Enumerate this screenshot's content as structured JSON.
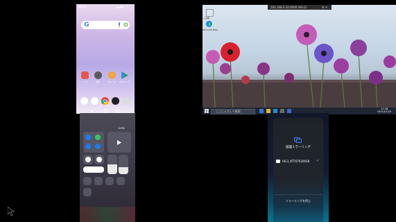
{
  "android": {
    "status_time": "11:48",
    "status_icons": "▲◢ ▮",
    "apps": [
      {
        "label": "ツール",
        "color": "#e6574a"
      },
      {
        "label": "設定",
        "color": "#5a5a5a"
      },
      {
        "label": "アルバム",
        "color": "#f2a63c"
      },
      {
        "label": "Playストア",
        "color": "#1fa463"
      }
    ],
    "dock": [
      {
        "name": "phone",
        "color": "#ffffff"
      },
      {
        "name": "messages",
        "color": "#ffffff"
      },
      {
        "name": "chrome",
        "color": "#e94235"
      },
      {
        "name": "camera",
        "color": "#202124"
      },
      {
        "name": "settings",
        "color": "#dadce0"
      }
    ]
  },
  "windows": {
    "topbar_text": "192.168.0.10:0000 (HS-2)",
    "topbar_right": "⚙ ✕",
    "desktop_icons": [
      {
        "label": "ごみ箱"
      },
      {
        "label": "Microsoft Edge"
      }
    ],
    "search_placeholder": "ここに入力して検索",
    "tray_time": "11:48",
    "tray_date": "2021/07/20"
  },
  "ios": {
    "status_text": "100%"
  },
  "mirror": {
    "title": "画面ミラーリング",
    "device": "HS-2_KT707020058",
    "stop": "ミラーリングを停止",
    "check": "✓"
  },
  "colors": {
    "background": "#000000",
    "windows_taskbar": "#1f2633",
    "mirror_accent": "#3b82f6"
  }
}
